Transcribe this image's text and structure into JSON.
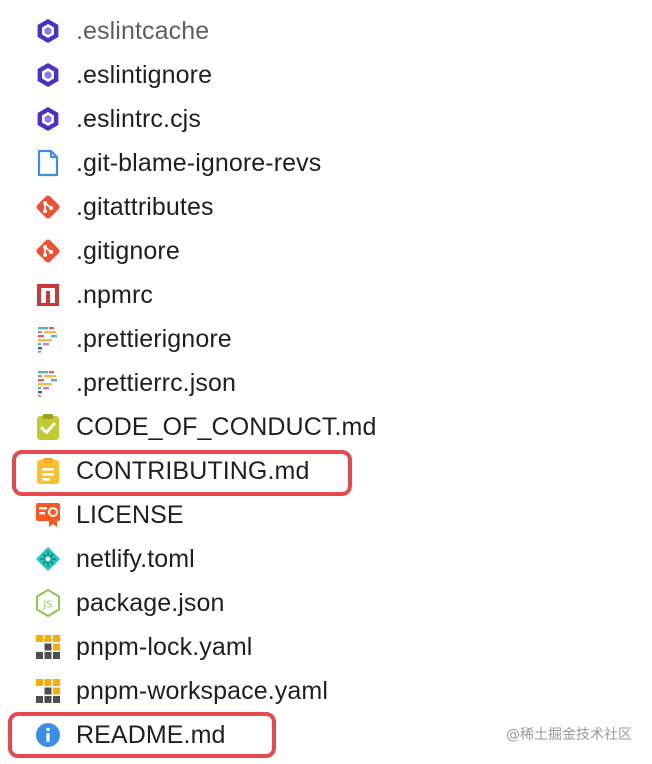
{
  "files": [
    {
      "name": ".eslintcache",
      "icon": "eslint-icon",
      "muted": true
    },
    {
      "name": ".eslintignore",
      "icon": "eslint-icon"
    },
    {
      "name": ".eslintrc.cjs",
      "icon": "eslint-icon"
    },
    {
      "name": ".git-blame-ignore-revs",
      "icon": "file-icon"
    },
    {
      "name": ".gitattributes",
      "icon": "git-icon"
    },
    {
      "name": ".gitignore",
      "icon": "git-icon"
    },
    {
      "name": ".npmrc",
      "icon": "npm-icon"
    },
    {
      "name": ".prettierignore",
      "icon": "prettier-icon"
    },
    {
      "name": ".prettierrc.json",
      "icon": "prettier-icon"
    },
    {
      "name": "CODE_OF_CONDUCT.md",
      "icon": "checklist-icon"
    },
    {
      "name": "CONTRIBUTING.md",
      "icon": "clipboard-icon",
      "highlighted": true
    },
    {
      "name": "LICENSE",
      "icon": "license-certificate-icon"
    },
    {
      "name": "netlify.toml",
      "icon": "netlify-icon"
    },
    {
      "name": "package.json",
      "icon": "nodejs-icon"
    },
    {
      "name": "pnpm-lock.yaml",
      "icon": "pnpm-icon"
    },
    {
      "name": "pnpm-workspace.yaml",
      "icon": "pnpm-icon"
    },
    {
      "name": "README.md",
      "icon": "info-icon",
      "highlighted": true
    }
  ],
  "watermark": "@稀土掘金技术社区",
  "colors": {
    "highlight_border": "#e5484d",
    "eslint": "#4b32c3",
    "git": "#f05133",
    "npm": "#cb3837",
    "info": "#3b8ee8",
    "pnpm": "#f9ad00",
    "netlify": "#20c6b7",
    "nodejs": "#8cc84b"
  }
}
